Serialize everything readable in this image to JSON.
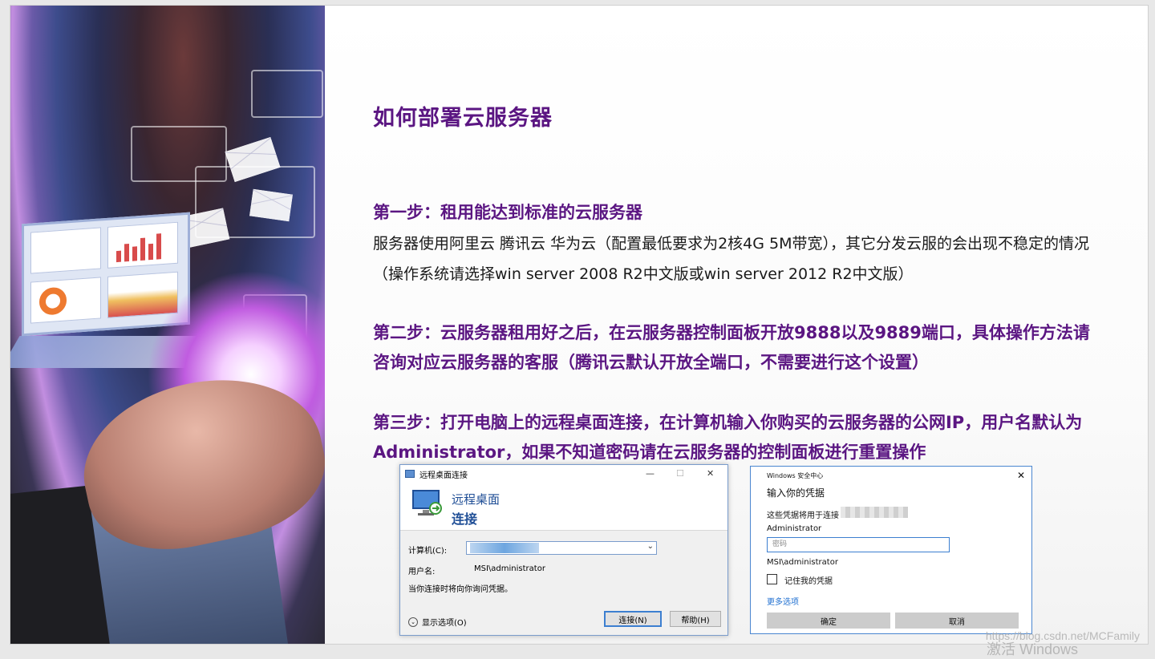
{
  "slide": {
    "title": "如何部署云服务器",
    "step1_heading": "第一步：租用能达到标准的云服务器",
    "step1_text": "服务器使用阿里云 腾讯云 华为云（配置最低要求为2核4G 5M带宽），其它分发云服的会出现不稳定的情况（操作系统请选择win server 2008 R2中文版或win server 2012 R2中文版）",
    "step2_heading": "第二步：云服务器租用好之后，在云服务器控制面板开放9888以及9889端口，具体操作方法请咨询对应云服务器的客服（腾讯云默认开放全端口，不需要进行这个设置）",
    "step3_heading": "第三步：打开电脑上的远程桌面连接，在计算机输入你购买的云服务器的公网IP，用户名默认为Administrator，如果不知道密码请在云服务器的控制面板进行重置操作"
  },
  "rdp_dialog": {
    "window_title": "远程桌面连接",
    "minimize": "—",
    "maximize": "☐",
    "close": "✕",
    "banner_line1": "远程桌面",
    "banner_line2": "连接",
    "computer_label": "计算机(C):",
    "username_label": "用户名:",
    "username_value": "MSI\\administrator",
    "prompt_note": "当你连接时将向你询问凭据。",
    "show_options": "显示选项(O)",
    "connect_button": "连接(N)",
    "help_button": "帮助(H)"
  },
  "security_dialog": {
    "header": "Windows 安全中心",
    "close": "✕",
    "heading": "输入你的凭据",
    "used_for": "这些凭据将用于连接",
    "account1": "Administrator",
    "password_placeholder": "密码",
    "account2": "MSI\\administrator",
    "remember": "记住我的凭据",
    "more_options": "更多选项",
    "ok_button": "确定",
    "cancel_button": "取消"
  },
  "overlay": {
    "watermark": "https://blog.csdn.net/MCFamily",
    "activate_text": "激活 Windows"
  },
  "colors": {
    "heading_purple": "#5b1682",
    "link_blue": "#1f6fd0"
  }
}
